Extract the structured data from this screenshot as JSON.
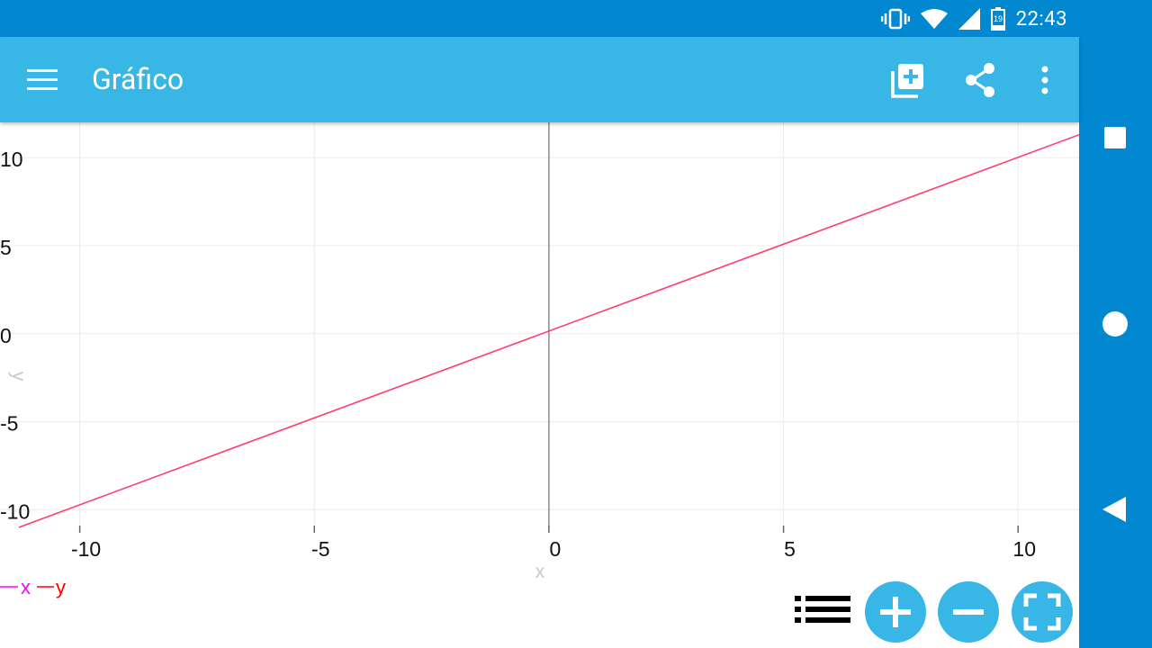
{
  "status_bar": {
    "time": "22:43",
    "battery_level": "19"
  },
  "app_bar": {
    "title": "Gráfico"
  },
  "colors": {
    "status_bar": "#0288d1",
    "app_bar": "#38b6e6",
    "line": "#ff3d6e",
    "legend_x": "#ff00ff",
    "legend_y": "#ff0000"
  },
  "chart_data": {
    "type": "line",
    "xlabel": "x",
    "ylabel": "y",
    "xlim": [
      -11.7,
      11.3
    ],
    "ylim": [
      -11.0,
      12.0
    ],
    "x_ticks": [
      -10,
      -5,
      0,
      5,
      10
    ],
    "y_ticks": [
      10,
      5,
      0,
      -5,
      -10
    ],
    "x_tick_labels": [
      "-10",
      "-5",
      "0",
      "5",
      "10"
    ],
    "y_tick_labels": [
      "10",
      "5",
      "0",
      "-5",
      "-10"
    ],
    "grid": true,
    "series": [
      {
        "name": "",
        "x": [
          -11.3,
          11.3
        ],
        "y": [
          -11.0,
          11.3
        ]
      }
    ],
    "legend": [
      "x",
      "y"
    ]
  }
}
